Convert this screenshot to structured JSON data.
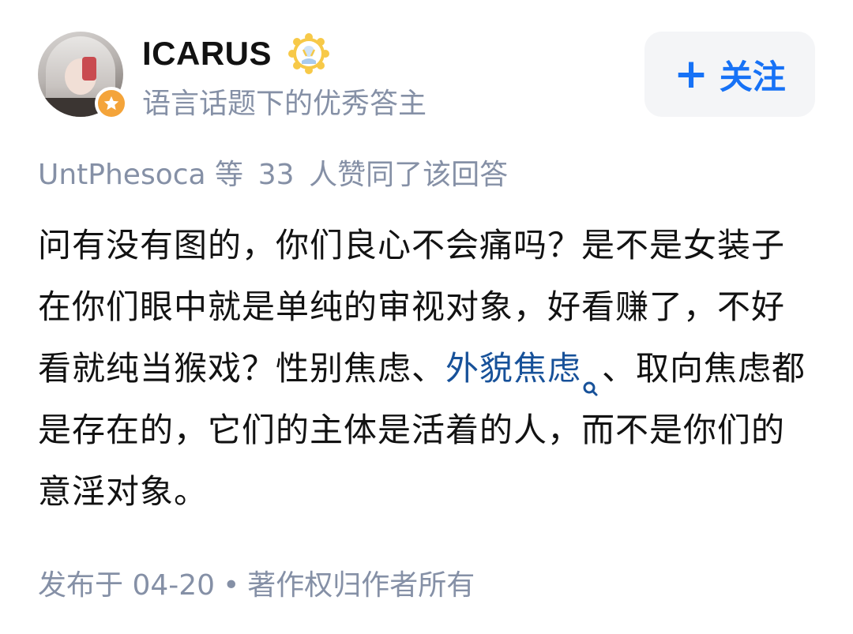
{
  "author": {
    "name": "ICARUS",
    "description": "语言话题下的优秀答主",
    "badge_icon": "star-badge-icon",
    "medal_icon": "sun-medal-icon"
  },
  "follow_button": {
    "plus": "+",
    "label": "关注"
  },
  "voters": {
    "name": "UntPhesoca",
    "prefix": "等",
    "count": "33",
    "suffix": "人赞同了该回答"
  },
  "content": {
    "text_before_link": "问有没有图的，你们良心不会痛吗？是不是女装子在你们眼中就是单纯的审视对象，好看赚了，不好看就纯当猴戏？性别焦虑、",
    "link_text": "外貌焦虑",
    "text_after_link": "、取向焦虑都是存在的，它们的主体是活着的人，而不是你们的意淫对象。"
  },
  "meta": {
    "published": "发布于 04-20",
    "separator": "•",
    "copyright": "著作权归作者所有"
  },
  "colors": {
    "accent": "#1772f6",
    "link": "#175199",
    "secondary_text": "#8590a6",
    "primary_text": "#121212",
    "badge": "#f4a43a"
  }
}
